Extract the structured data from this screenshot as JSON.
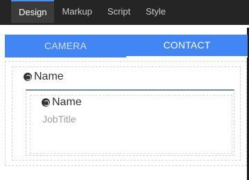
{
  "editor_tabs": [
    {
      "label": "Design",
      "active": true
    },
    {
      "label": "Markup",
      "active": false
    },
    {
      "label": "Script",
      "active": false
    },
    {
      "label": "Style",
      "active": false
    }
  ],
  "segmented": {
    "items": [
      {
        "label": "CAMERA",
        "active": false
      },
      {
        "label": "CONTACT",
        "active": true
      }
    ]
  },
  "form": {
    "outer_name_label": "Name",
    "card": {
      "name_label": "Name",
      "job_title_label": "JobTitle"
    }
  },
  "icons": {
    "field_icon": "link-icon"
  },
  "colors": {
    "topbar": "#252526",
    "active_tab": "#3b3b3b",
    "accent": "#4285f4"
  }
}
